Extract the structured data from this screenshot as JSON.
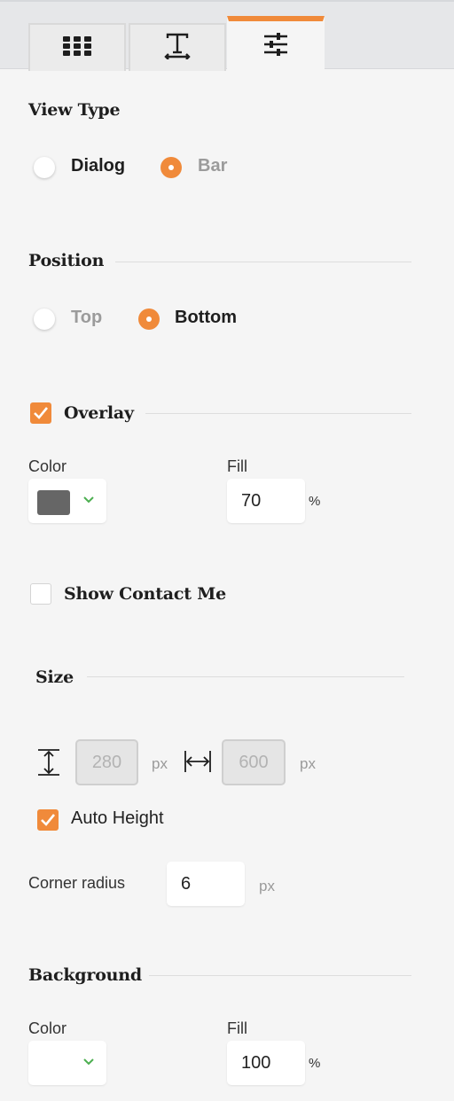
{
  "tabs": [
    {
      "icon": "grid-icon"
    },
    {
      "icon": "text-format-icon"
    },
    {
      "icon": "sliders-icon",
      "active": true
    }
  ],
  "view_type": {
    "heading": "View Type",
    "options": [
      "Dialog",
      "Bar"
    ],
    "selected": "Bar"
  },
  "position": {
    "heading": "Position",
    "options": [
      "Top",
      "Bottom"
    ],
    "selected": "Bottom"
  },
  "overlay": {
    "label": "Overlay",
    "checked": true,
    "color_label": "Color",
    "color_value": "#666666",
    "fill_label": "Fill",
    "fill_value": "70",
    "fill_unit": "%"
  },
  "contact": {
    "label": "Show Contact Me",
    "checked": false
  },
  "size": {
    "heading": "Size",
    "height_value": "280",
    "width_value": "600",
    "unit": "px",
    "auto_height_label": "Auto Height",
    "auto_height_checked": true,
    "corner_label": "Corner radius",
    "corner_value": "6",
    "corner_unit": "px"
  },
  "background": {
    "heading": "Background",
    "color_label": "Color",
    "fill_label": "Fill",
    "fill_value": "100",
    "fill_unit": "%"
  },
  "colors": {
    "accent": "#f08a3a",
    "chevron": "#4caf50"
  }
}
